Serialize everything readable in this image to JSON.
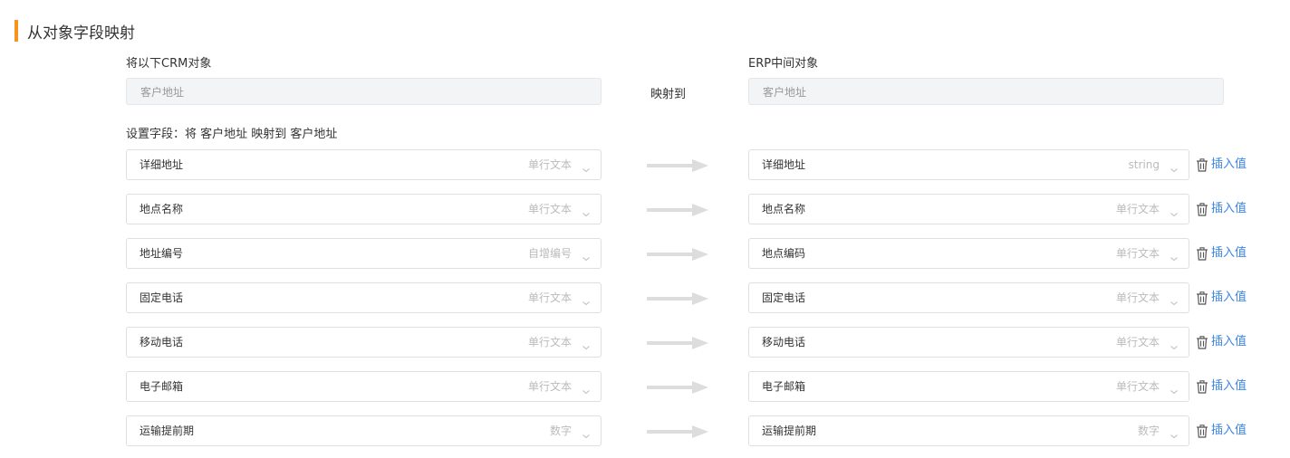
{
  "section": {
    "title": "从对象字段映射"
  },
  "source": {
    "label": "将以下CRM对象",
    "value": "客户地址"
  },
  "map_to_label": "映射到",
  "target": {
    "label": "ERP中间对象",
    "value": "客户地址"
  },
  "field_setting_label": "设置字段：将 客户地址 映射到 客户地址",
  "insert_label": "插入值",
  "mappings": [
    {
      "crm_field": "详细地址",
      "crm_type": "单行文本",
      "erp_field": "详细地址",
      "erp_type": "string"
    },
    {
      "crm_field": "地点名称",
      "crm_type": "单行文本",
      "erp_field": "地点名称",
      "erp_type": "单行文本"
    },
    {
      "crm_field": "地址编号",
      "crm_type": "自增编号",
      "erp_field": "地点编码",
      "erp_type": "单行文本"
    },
    {
      "crm_field": "固定电话",
      "crm_type": "单行文本",
      "erp_field": "固定电话",
      "erp_type": "单行文本"
    },
    {
      "crm_field": "移动电话",
      "crm_type": "单行文本",
      "erp_field": "移动电话",
      "erp_type": "单行文本"
    },
    {
      "crm_field": "电子邮箱",
      "crm_type": "单行文本",
      "erp_field": "电子邮箱",
      "erp_type": "单行文本"
    },
    {
      "crm_field": "运输提前期",
      "crm_type": "数字",
      "erp_field": "运输提前期",
      "erp_type": "数字"
    }
  ],
  "colors": {
    "accent_bar": "#f7941d",
    "link": "#3a86e6"
  }
}
